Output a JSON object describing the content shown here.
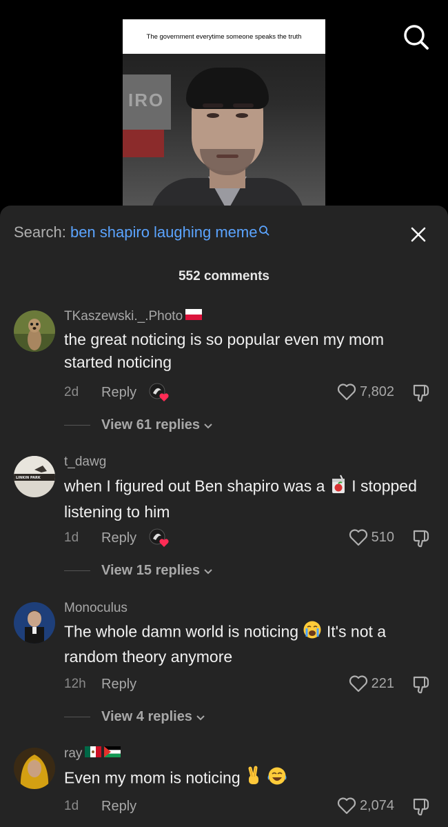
{
  "video": {
    "caption": "The government everytime someone speaks the truth",
    "background_letters": "IRO"
  },
  "search": {
    "label": "Search:",
    "term": "ben shapiro laughing meme"
  },
  "comment_count": "552 comments",
  "comments": [
    {
      "username": "TKaszewski._.Photo",
      "text": "the great noticing is so popular even my mom started noticing",
      "age": "2d",
      "reply": "Reply",
      "likes": "7,802",
      "view_replies": "View 61 replies"
    },
    {
      "username": "t_dawg",
      "avatar_text": "LINKIN PARK",
      "text_a": "when I figured out Ben shapiro was a",
      "text_b": "I stopped listening to him",
      "age": "1d",
      "reply": "Reply",
      "likes": "510",
      "view_replies": "View 15 replies"
    },
    {
      "username": "Monoculus",
      "text_a": "The whole damn world is noticing",
      "text_b": "It's not a random theory anymore",
      "age": "12h",
      "reply": "Reply",
      "likes": "221",
      "view_replies": "View 4 replies"
    },
    {
      "username": "ray",
      "text": "Even my mom is noticing",
      "age": "1d",
      "reply": "Reply",
      "likes": "2,074"
    }
  ],
  "colors": {
    "panel_bg": "#242424",
    "search_term": "#5ba4ff",
    "liked_heart": "#fe2c55"
  },
  "icons": [
    "search-icon",
    "close-icon",
    "heart-icon",
    "dislike-icon",
    "chevron-down-icon",
    "poland-flag-icon",
    "mexico-flag-icon",
    "palestine-flag-icon",
    "juice-box-emoji",
    "crying-face-emoji",
    "victory-hand-emoji",
    "tears-of-joy-emoji"
  ]
}
